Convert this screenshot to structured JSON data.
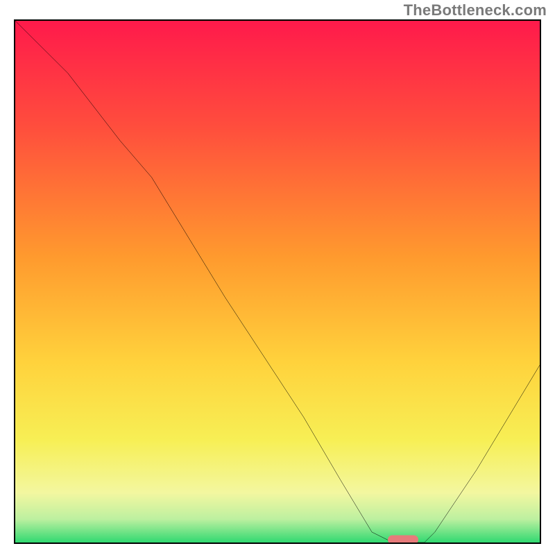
{
  "watermark": "TheBottleneck.com",
  "chart_data": {
    "type": "line",
    "title": "",
    "xlabel": "",
    "ylabel": "",
    "xlim": [
      0,
      100
    ],
    "ylim": [
      0,
      100
    ],
    "grid": false,
    "series": [
      {
        "name": "curve",
        "x": [
          0,
          10,
          20,
          26,
          40,
          55,
          62,
          68,
          72,
          78,
          80,
          88,
          100
        ],
        "values": [
          100,
          90,
          77,
          70,
          47,
          24,
          12,
          2,
          0,
          0,
          2,
          14,
          34
        ]
      }
    ],
    "marker": {
      "x": 74,
      "y": 0.5
    },
    "background_gradient_stops": [
      {
        "pos": 0,
        "color": "#ff1a4b"
      },
      {
        "pos": 20,
        "color": "#ff4d3d"
      },
      {
        "pos": 45,
        "color": "#ff9a2e"
      },
      {
        "pos": 65,
        "color": "#ffd23c"
      },
      {
        "pos": 80,
        "color": "#f7ef55"
      },
      {
        "pos": 90,
        "color": "#f3f7a0"
      },
      {
        "pos": 95,
        "color": "#bdf0a0"
      },
      {
        "pos": 100,
        "color": "#20d66b"
      }
    ],
    "curve_color": "#000000",
    "marker_color": "#e77b7b"
  }
}
